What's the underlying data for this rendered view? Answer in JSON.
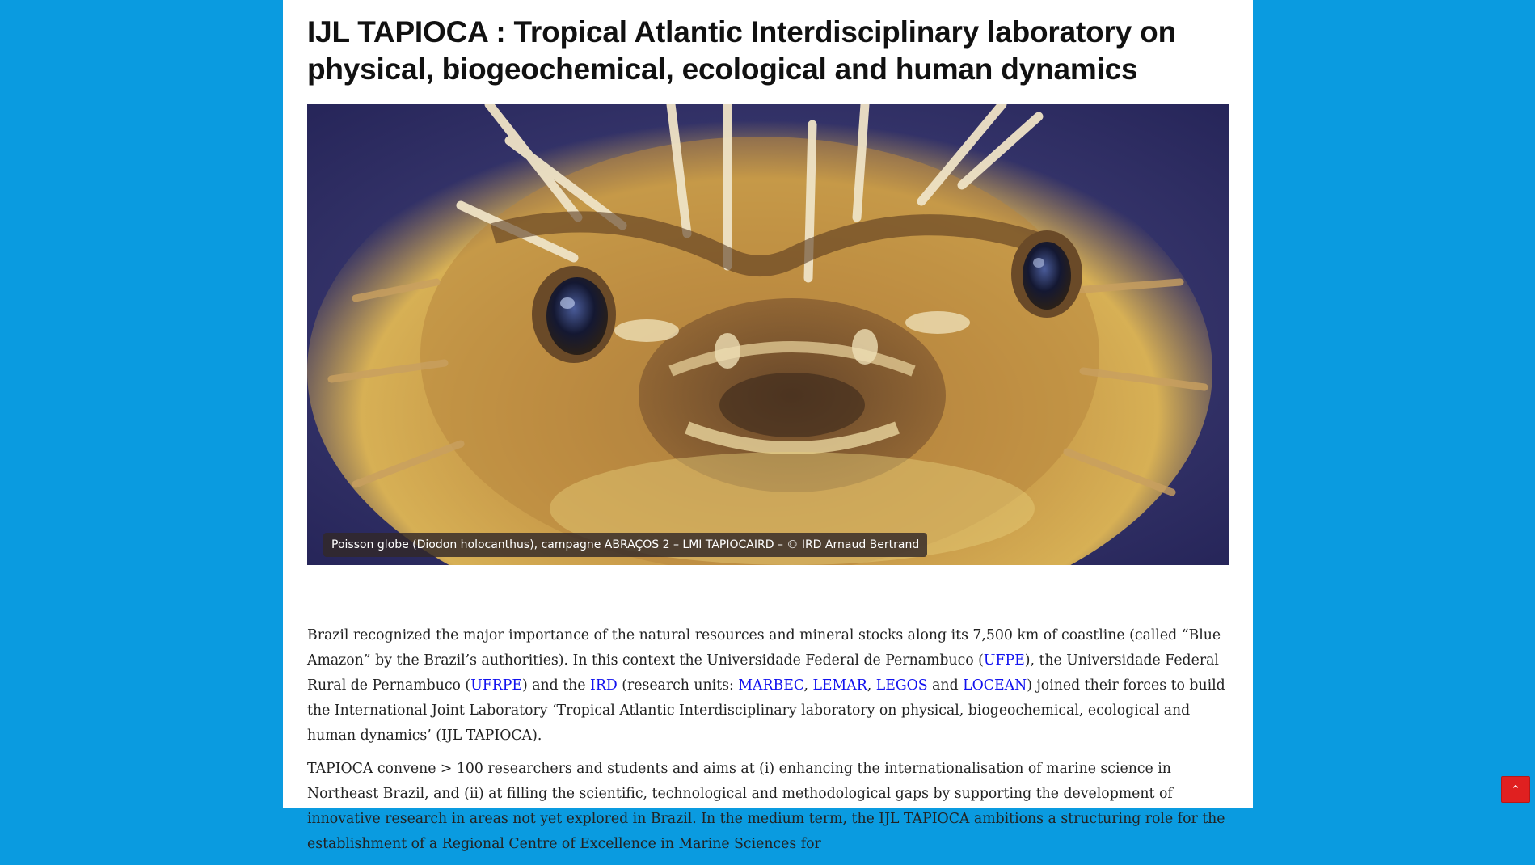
{
  "article": {
    "title": "IJL TAPIOCA : Tropical Atlantic Interdisciplinary laboratory on physical, biogeochemical, ecological and human dynamics",
    "image": {
      "subject": "pufferfish photo",
      "caption": "Poisson globe (Diodon holocanthus), campagne ABRAÇOS 2 – LMI TAPIOCAIRD – © IRD Arnaud Bertrand"
    },
    "p1": {
      "t1": "Brazil recognized the major importance of the natural resources and mineral stocks along its 7,500 km of coastline (called “Blue Amazon” by the Brazil’s authorities).  In this context the Universidade Federal de Pernambuco (",
      "link_ufpe": "UFPE",
      "t2": "), the Universidade Federal Rural de Pernambuco (",
      "link_ufrpe": "UFRPE",
      "t3": ") and the ",
      "link_ird": "IRD",
      "t4": " (research units: ",
      "link_marbec": "MARBEC",
      "t5": ", ",
      "link_lemar": "LEMAR",
      "t6": ", ",
      "link_legos": "LEGOS",
      "t7": " and ",
      "link_locean": "LOCEAN",
      "t8": ") joined their forces to build the International Joint Laboratory ‘Tropical Atlantic Interdisciplinary laboratory on physical, biogeochemical, ecological and human dynamics’ (IJL TAPIOCA)."
    },
    "p2": "TAPIOCA convene > 100 researchers and students and aims at (i) enhancing the internationalisation of marine science in Northeast Brazil, and (ii) at filling the scientific, technological and methodological gaps by supporting the development of innovative research in areas not yet explored in Brazil. In the medium term, the IJL TAPIOCA ambitions a structuring role for the establishment of a Regional Centre of Excellence in Marine Sciences for"
  },
  "scroll_top": {
    "icon": "chevron-up-icon",
    "symbol": "⌃"
  },
  "colors": {
    "background": "#0a9be0",
    "link": "#1111ee",
    "scroll_button": "#e02020"
  }
}
